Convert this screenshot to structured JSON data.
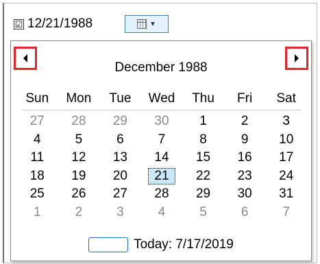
{
  "picker": {
    "checked": true,
    "checkmark": "☑",
    "value": "12/21/1988",
    "dropdown_icon": "calendar-icon"
  },
  "calendar": {
    "month_title": "December 1988",
    "prev_icon": "triangle-left",
    "next_icon": "triangle-right",
    "highlight_color": "#e0262b",
    "weekdays": [
      "Sun",
      "Mon",
      "Tue",
      "Wed",
      "Thu",
      "Fri",
      "Sat"
    ],
    "weeks": [
      [
        {
          "d": "27",
          "other": true
        },
        {
          "d": "28",
          "other": true
        },
        {
          "d": "29",
          "other": true
        },
        {
          "d": "30",
          "other": true
        },
        {
          "d": "1"
        },
        {
          "d": "2"
        },
        {
          "d": "3"
        }
      ],
      [
        {
          "d": "4"
        },
        {
          "d": "5"
        },
        {
          "d": "6"
        },
        {
          "d": "7"
        },
        {
          "d": "8"
        },
        {
          "d": "9"
        },
        {
          "d": "10"
        }
      ],
      [
        {
          "d": "11"
        },
        {
          "d": "12"
        },
        {
          "d": "13"
        },
        {
          "d": "14"
        },
        {
          "d": "15"
        },
        {
          "d": "16"
        },
        {
          "d": "17"
        }
      ],
      [
        {
          "d": "18"
        },
        {
          "d": "19"
        },
        {
          "d": "20"
        },
        {
          "d": "21",
          "selected": true
        },
        {
          "d": "22"
        },
        {
          "d": "23"
        },
        {
          "d": "24"
        }
      ],
      [
        {
          "d": "25"
        },
        {
          "d": "26"
        },
        {
          "d": "27"
        },
        {
          "d": "28"
        },
        {
          "d": "29"
        },
        {
          "d": "30"
        },
        {
          "d": "31"
        }
      ],
      [
        {
          "d": "1",
          "other": true
        },
        {
          "d": "2",
          "other": true
        },
        {
          "d": "3",
          "other": true
        },
        {
          "d": "4",
          "other": true
        },
        {
          "d": "5",
          "other": true
        },
        {
          "d": "6",
          "other": true
        },
        {
          "d": "7",
          "other": true
        }
      ]
    ],
    "today_label": "Today: 7/17/2019",
    "selected_color": "#cce8ff"
  }
}
